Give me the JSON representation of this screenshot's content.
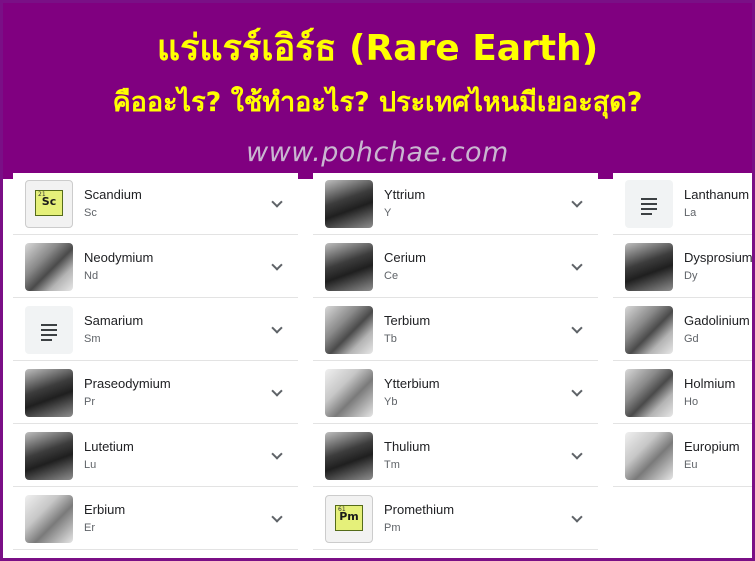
{
  "banner": {
    "title": "แร่แรร์เอิร์ธ (Rare Earth)",
    "subtitle": "คืออะไร? ใช้ทำอะไร? ประเทศไหนมีเยอะสุด?",
    "url": "www.pohchae.com"
  },
  "columns": [
    {
      "elements": [
        {
          "name": "Scandium",
          "symbol": "Sc",
          "thumb": "tile",
          "tile_symbol": "Sc",
          "tile_number": "21"
        },
        {
          "name": "Neodymium",
          "symbol": "Nd",
          "thumb": "metal"
        },
        {
          "name": "Samarium",
          "symbol": "Sm",
          "thumb": "text"
        },
        {
          "name": "Praseodymium",
          "symbol": "Pr",
          "thumb": "dark"
        },
        {
          "name": "Lutetium",
          "symbol": "Lu",
          "thumb": "dark"
        },
        {
          "name": "Erbium",
          "symbol": "Er",
          "thumb": "bright"
        }
      ]
    },
    {
      "elements": [
        {
          "name": "Yttrium",
          "symbol": "Y",
          "thumb": "dark"
        },
        {
          "name": "Cerium",
          "symbol": "Ce",
          "thumb": "dark"
        },
        {
          "name": "Terbium",
          "symbol": "Tb",
          "thumb": "metal"
        },
        {
          "name": "Ytterbium",
          "symbol": "Yb",
          "thumb": "bright"
        },
        {
          "name": "Thulium",
          "symbol": "Tm",
          "thumb": "dark"
        },
        {
          "name": "Promethium",
          "symbol": "Pm",
          "thumb": "tile",
          "tile_symbol": "Pm",
          "tile_number": "61"
        }
      ]
    },
    {
      "elements": [
        {
          "name": "Lanthanum",
          "symbol": "La",
          "thumb": "text"
        },
        {
          "name": "Dysprosium",
          "symbol": "Dy",
          "thumb": "dark"
        },
        {
          "name": "Gadolinium",
          "symbol": "Gd",
          "thumb": "metal"
        },
        {
          "name": "Holmium",
          "symbol": "Ho",
          "thumb": "metal"
        },
        {
          "name": "Europium",
          "symbol": "Eu",
          "thumb": "bright"
        }
      ]
    }
  ],
  "colors": {
    "banner_bg": "#800080",
    "banner_text": "#ffff00",
    "url_text": "#c9b7d0"
  },
  "icons": {
    "expand": "chevron-down-icon",
    "no_image": "notes-icon"
  }
}
